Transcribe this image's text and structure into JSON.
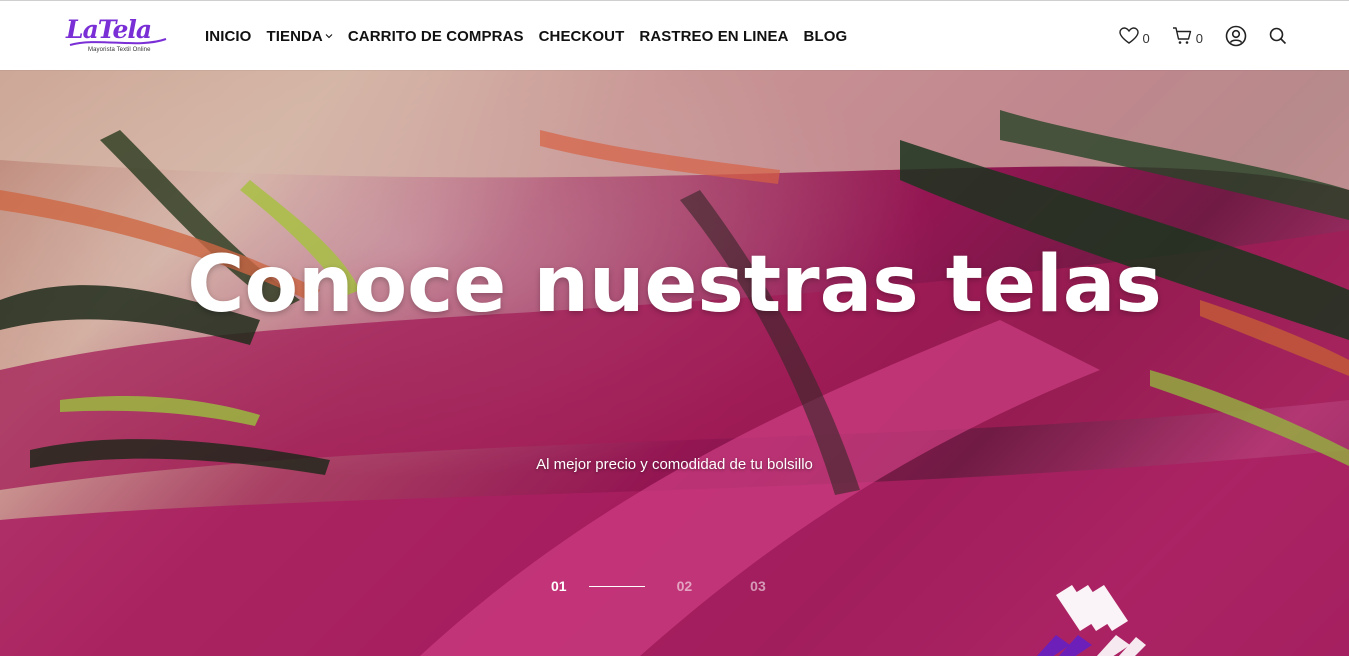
{
  "brand": {
    "name": "LaTela",
    "tagline": "Mayorista Textil Online",
    "color": "#7a2fd6"
  },
  "nav": {
    "items": [
      {
        "label": "INICIO"
      },
      {
        "label": "TIENDA",
        "has_dropdown": true
      },
      {
        "label": "CARRITO DE COMPRAS"
      },
      {
        "label": "CHECKOUT"
      },
      {
        "label": "RASTREO EN LINEA"
      },
      {
        "label": "BLOG"
      }
    ]
  },
  "tools": {
    "wishlist_count": "0",
    "cart_count": "0",
    "icons": [
      "heart-icon",
      "cart-icon",
      "user-icon",
      "search-icon"
    ]
  },
  "hero": {
    "title": "Conoce nuestras telas",
    "subtitle": "Al mejor precio y comodidad de tu bolsillo",
    "slides": [
      {
        "label": "01",
        "active": true
      },
      {
        "label": "02",
        "active": false
      },
      {
        "label": "03",
        "active": false
      }
    ]
  }
}
